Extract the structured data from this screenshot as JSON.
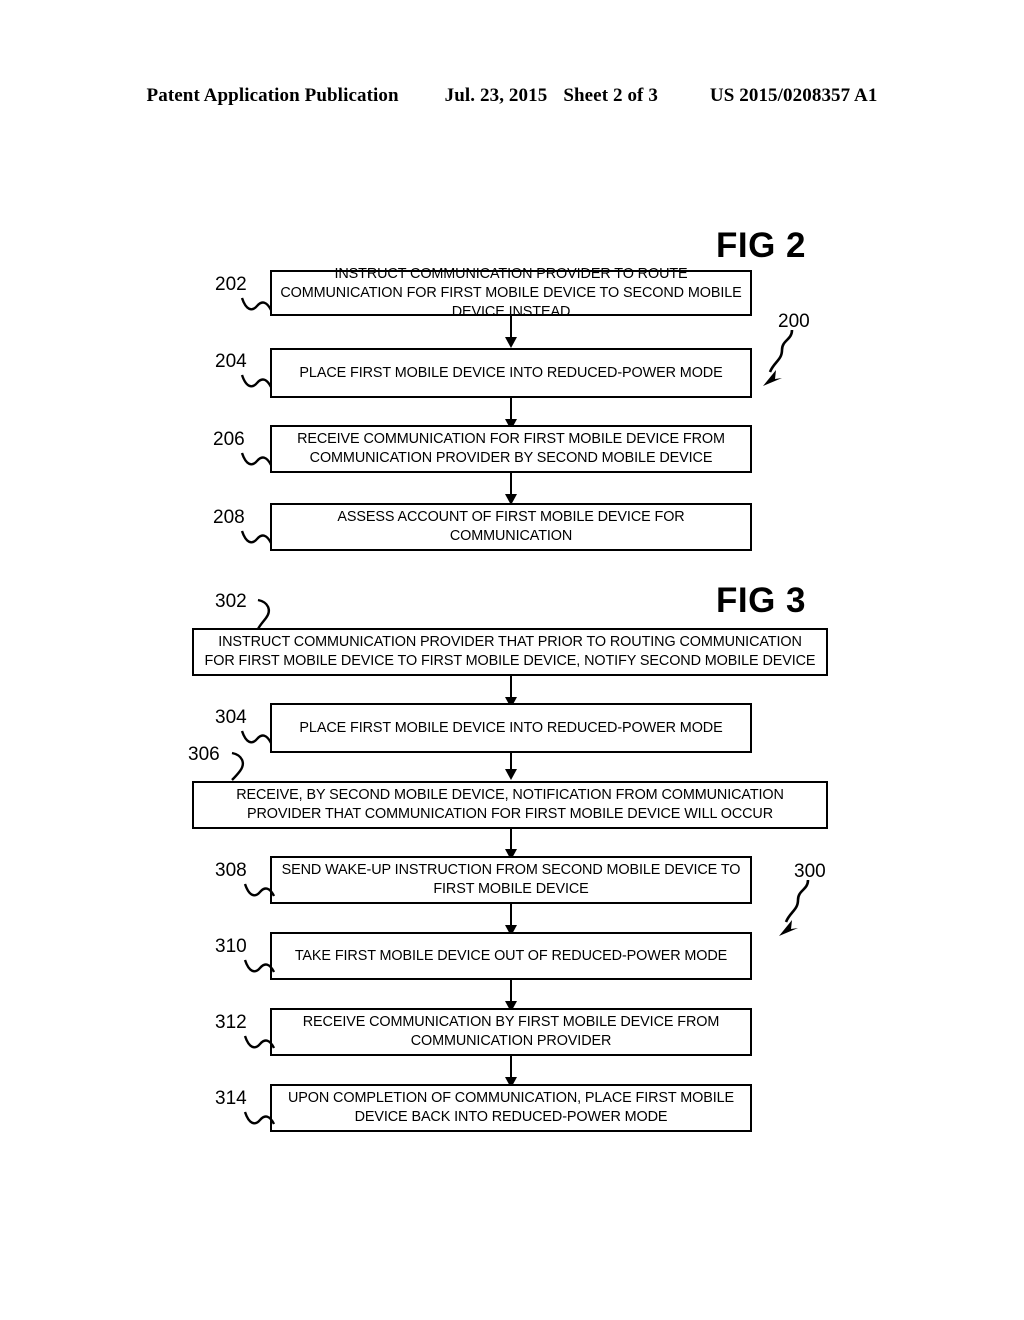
{
  "header": {
    "left": "Patent Application Publication",
    "date": "Jul. 23, 2015",
    "sheet": "Sheet 2 of 3",
    "publication_number": "US 2015/0208357 A1"
  },
  "figures": [
    {
      "title": "FIG 2",
      "id_label": "200",
      "steps": [
        {
          "ref": "202",
          "text": "INSTRUCT COMMUNICATION PROVIDER TO ROUTE COMMUNICATION FOR FIRST MOBILE DEVICE TO SECOND MOBILE DEVICE INSTEAD"
        },
        {
          "ref": "204",
          "text": "PLACE FIRST MOBILE DEVICE INTO REDUCED-POWER MODE"
        },
        {
          "ref": "206",
          "text": "RECEIVE COMMUNICATION FOR FIRST MOBILE DEVICE FROM COMMUNICATION PROVIDER BY SECOND MOBILE DEVICE"
        },
        {
          "ref": "208",
          "text": "ASSESS ACCOUNT OF FIRST MOBILE DEVICE FOR COMMUNICATION"
        }
      ]
    },
    {
      "title": "FIG 3",
      "id_label": "300",
      "steps": [
        {
          "ref": "302",
          "text": "INSTRUCT COMMUNICATION PROVIDER THAT PRIOR TO ROUTING COMMUNICATION FOR FIRST MOBILE DEVICE TO FIRST MOBILE DEVICE, NOTIFY SECOND MOBILE DEVICE"
        },
        {
          "ref": "304",
          "text": "PLACE FIRST MOBILE DEVICE INTO REDUCED-POWER MODE"
        },
        {
          "ref": "306",
          "text": "RECEIVE, BY SECOND MOBILE DEVICE, NOTIFICATION FROM COMMUNICATION PROVIDER THAT COMMUNICATION FOR FIRST MOBILE DEVICE WILL OCCUR"
        },
        {
          "ref": "308",
          "text": "SEND WAKE-UP INSTRUCTION FROM SECOND MOBILE DEVICE TO FIRST MOBILE DEVICE"
        },
        {
          "ref": "310",
          "text": "TAKE FIRST MOBILE DEVICE OUT OF REDUCED-POWER MODE"
        },
        {
          "ref": "312",
          "text": "RECEIVE COMMUNICATION BY FIRST MOBILE DEVICE FROM COMMUNICATION PROVIDER"
        },
        {
          "ref": "314",
          "text": "UPON COMPLETION OF COMMUNICATION, PLACE FIRST MOBILE DEVICE BACK INTO REDUCED-POWER MODE"
        }
      ]
    }
  ],
  "colors": {
    "ink": "#000000",
    "paper": "#ffffff"
  }
}
